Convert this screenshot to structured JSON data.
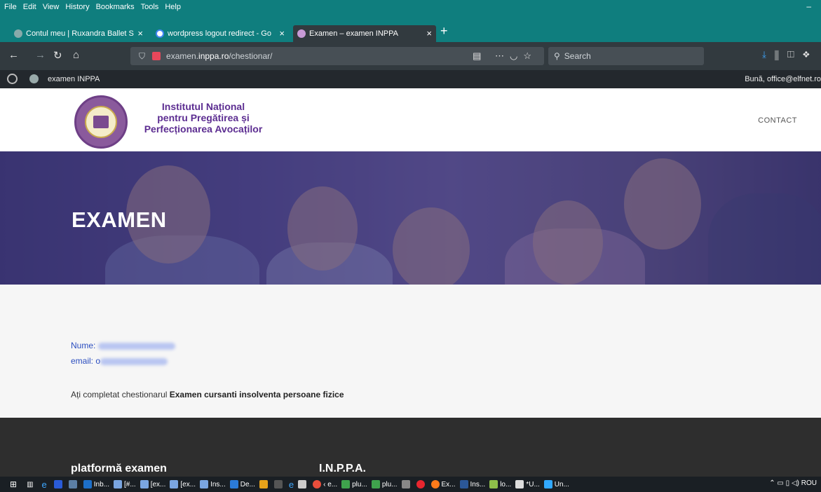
{
  "menubar": {
    "items": [
      "File",
      "Edit",
      "View",
      "History",
      "Bookmarks",
      "Tools",
      "Help"
    ],
    "minimize": "–"
  },
  "tabs": [
    {
      "label": "Contul meu | Ruxandra Ballet S",
      "active": false
    },
    {
      "label": "wordpress logout redirect - Go",
      "active": false
    },
    {
      "label": "Examen – examen INPPA",
      "active": true
    }
  ],
  "newtab": "+",
  "nav": {
    "url_prefix": "examen.",
    "url_domain": "inppa.ro",
    "url_path": "/chestionar/",
    "search_placeholder": "Search"
  },
  "wpbar": {
    "site": "examen INPPA",
    "greeting": "Bună, office@elfnet.ro"
  },
  "header": {
    "brand_line1": "Institutul Național",
    "brand_line2": "pentru Pregătirea și",
    "brand_line3": "Perfecționarea Avocaților",
    "nav_contact": "CONTACT"
  },
  "hero": {
    "title": "EXAMEN"
  },
  "content": {
    "name_label": "Nume:",
    "email_label": "email:",
    "email_prefix": "o",
    "message_prefix": "Ați completat chestionarul",
    "message_bold": "Examen cursanti insolventa persoane fizice"
  },
  "footer": {
    "col1_title": "platformă examen",
    "col2_title": "I.N.P.P.A."
  },
  "taskbar": {
    "items": [
      "Inb...",
      "[#...",
      "[ex...",
      "[ex...",
      "Ins...",
      "De...",
      "‹ e...",
      "plu...",
      "plu...",
      "Ex...",
      "Ins...",
      "lo...",
      "*U...",
      "Un..."
    ],
    "lang": "ROU"
  },
  "colors": {
    "chrome_teal": "#0f7e7e",
    "toolbar": "#323a3f",
    "wp_admin": "#23282d",
    "brand_purple": "#5c2d91",
    "link_blue": "#2a4dbf",
    "footer": "#2e2e2e"
  }
}
